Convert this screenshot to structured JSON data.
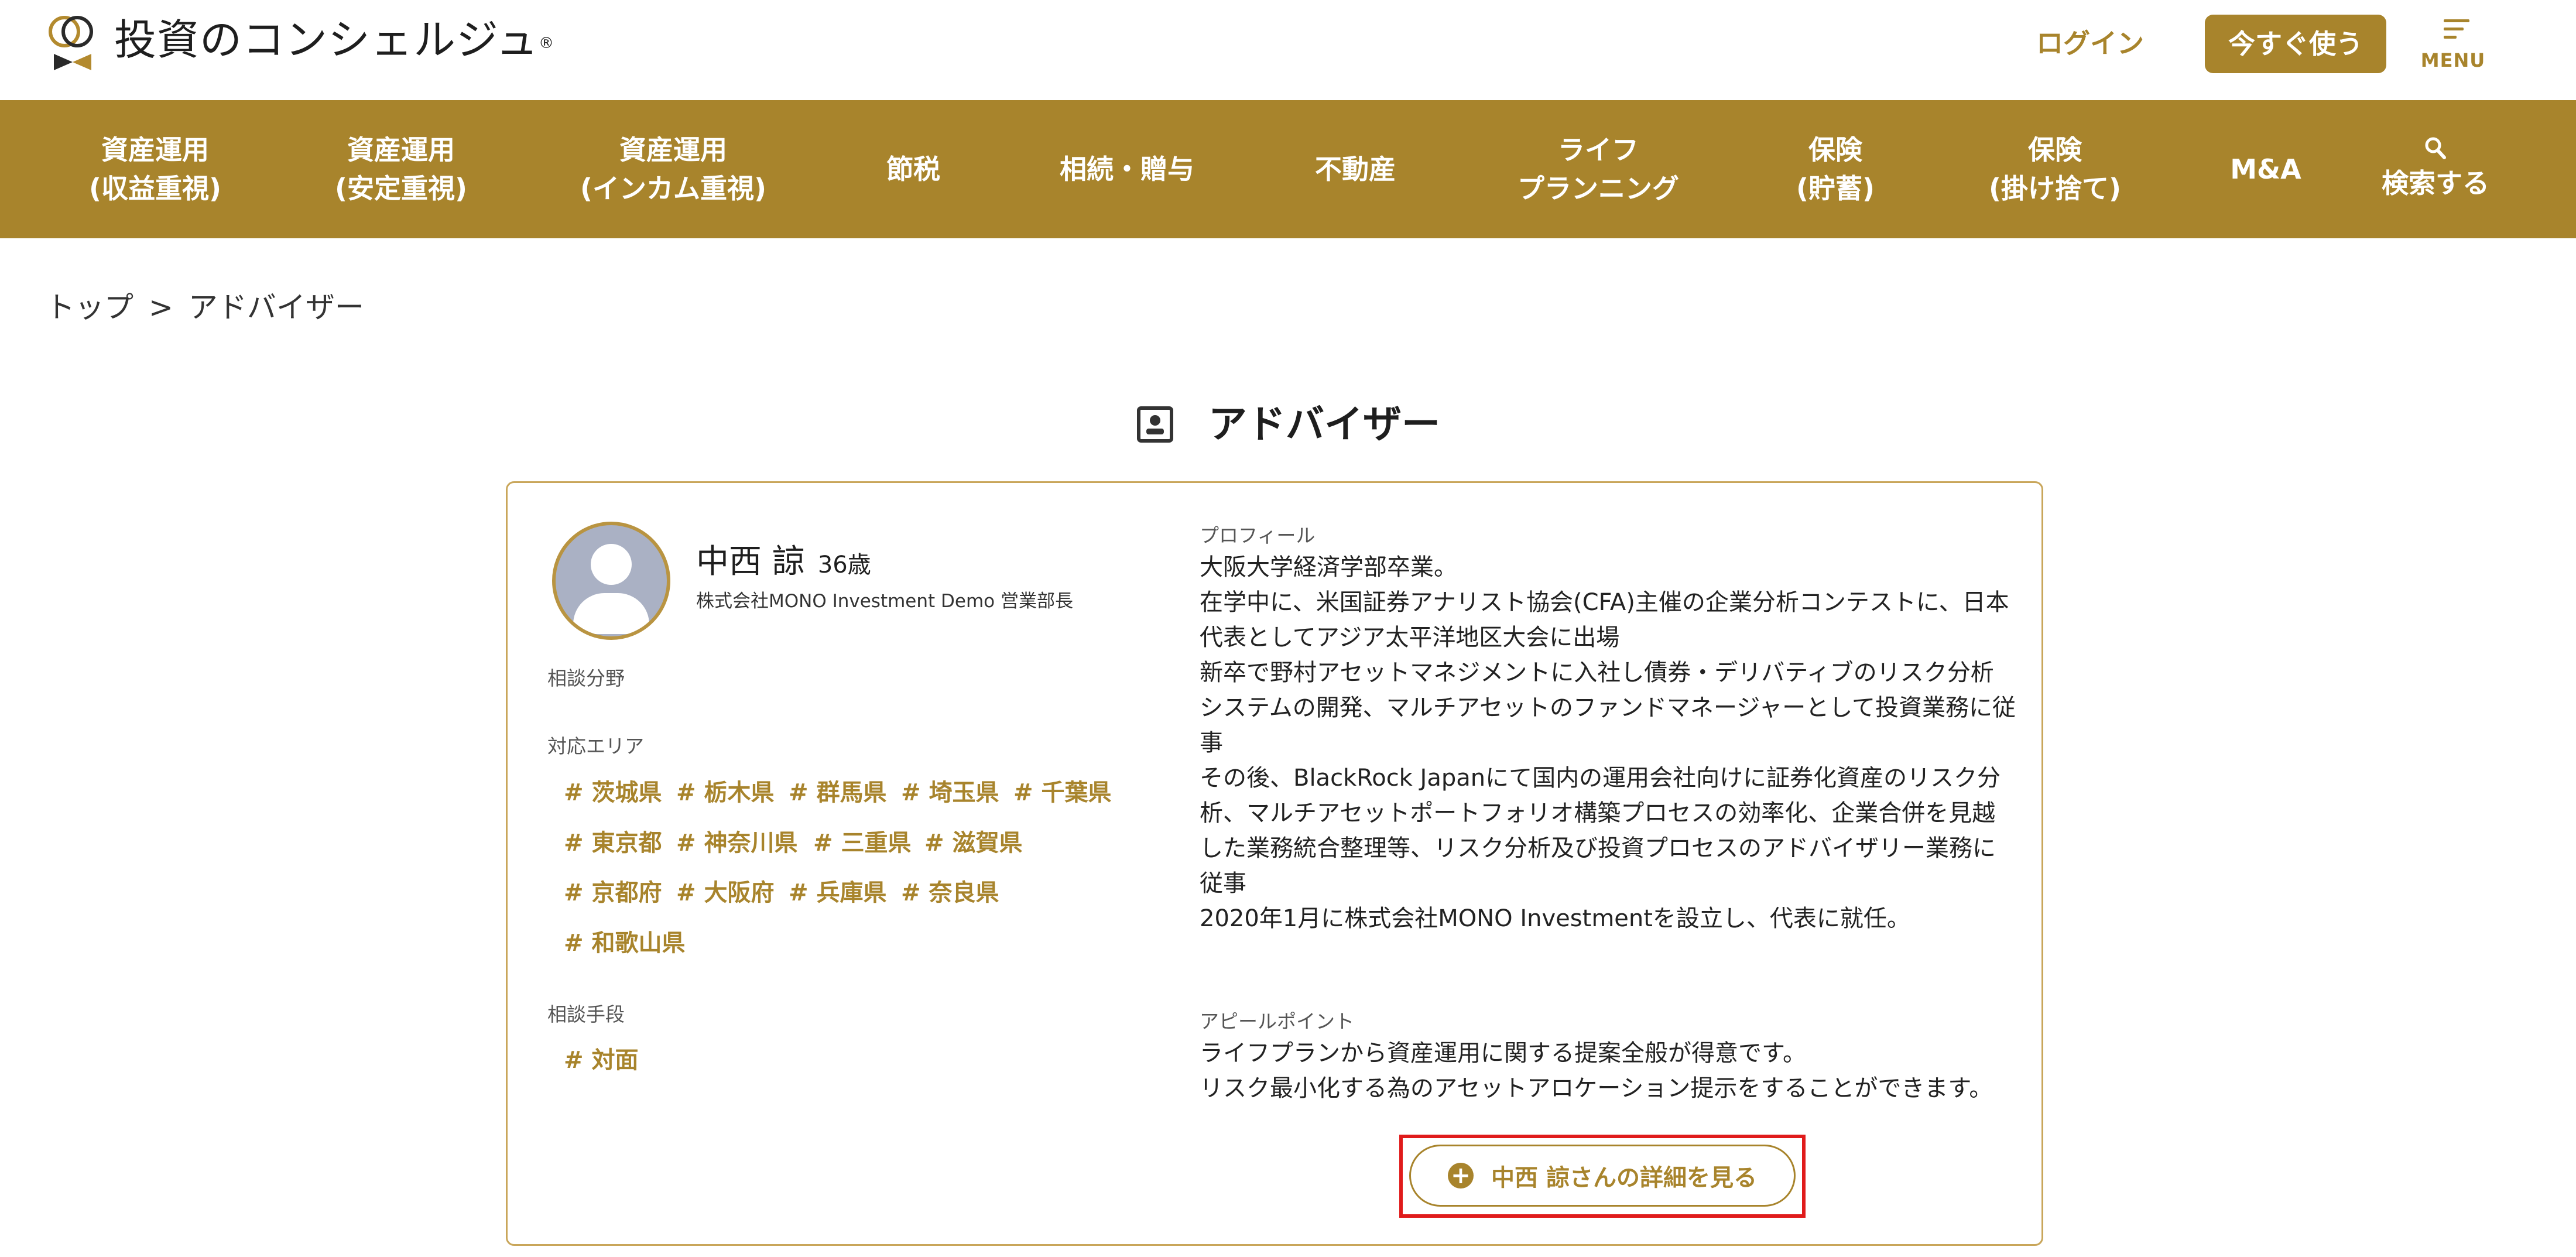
{
  "header": {
    "logo_text": "投資のコンシェルジュ",
    "logo_mark": "®",
    "login_label": "ログイン",
    "cta_label": "今すぐ使う",
    "menu_label": "MENU"
  },
  "nav": {
    "items": [
      {
        "lines": [
          "資産運用",
          "(収益重視)"
        ]
      },
      {
        "lines": [
          "資産運用",
          "(安定重視)"
        ]
      },
      {
        "lines": [
          "資産運用",
          "(インカム重視)"
        ]
      },
      {
        "lines": [
          "節税"
        ]
      },
      {
        "lines": [
          "相続・贈与"
        ]
      },
      {
        "lines": [
          "不動産"
        ]
      },
      {
        "lines": [
          "ライフ",
          "プランニング"
        ]
      },
      {
        "lines": [
          "保険",
          "(貯蓄)"
        ]
      },
      {
        "lines": [
          "保険",
          "(掛け捨て)"
        ]
      },
      {
        "lines": [
          "M&A"
        ]
      },
      {
        "lines": [
          "検索する"
        ],
        "icon": "search-icon"
      }
    ]
  },
  "breadcrumb": {
    "home": "トップ",
    "separator": ">",
    "current": "アドバイザー"
  },
  "page": {
    "title": "アドバイザー",
    "title_icon": "person-card-icon"
  },
  "advisor": {
    "name": "中西 諒",
    "age": "36歳",
    "company": "株式会社MONO Investment Demo 営業部長",
    "consult_field_label": "相談分野",
    "area_label": "対応エリア",
    "areas": [
      "# 茨城県",
      "# 栃木県",
      "# 群馬県",
      "# 埼玉県",
      "# 千葉県",
      "# 東京都",
      "# 神奈川県",
      "# 三重県",
      "# 滋賀県",
      "# 京都府",
      "# 大阪府",
      "# 兵庫県",
      "# 奈良県",
      "# 和歌山県"
    ],
    "method_label": "相談手段",
    "methods": [
      "# 対面"
    ],
    "profile_label": "プロフィール",
    "profile_lines": [
      "大阪大学経済学部卒業。",
      "在学中に、米国証券アナリスト協会(CFA)主催の企業分析コンテストに、日本",
      "代表としてアジア太平洋地区大会に出場",
      "新卒で野村アセットマネジメントに入社し債券・デリバティブのリスク分析",
      "システムの開発、マルチアセットのファンドマネージャーとして投資業務に従",
      "事",
      "その後、BlackRock Japanにて国内の運用会社向けに証券化資産のリスク分",
      "析、マルチアセットポートフォリオ構築プロセスの効率化、企業合併を見越",
      "した業務統合整理等、リスク分析及び投資プロセスのアドバイザリー業務に",
      "従事",
      "2020年1月に株式会社MONO Investmentを設立し、代表に就任。"
    ],
    "appeal_label": "アピールポイント",
    "appeal_lines": [
      "ライフプランから資産運用に関する提案全般が得意です。",
      "リスク最小化する為のアセットアロケーション提示をすることができます。"
    ],
    "detail_button_label": "中西 諒さんの詳細を見る"
  },
  "colors": {
    "brand": "#a8842c",
    "highlight": "#e01b1b"
  }
}
